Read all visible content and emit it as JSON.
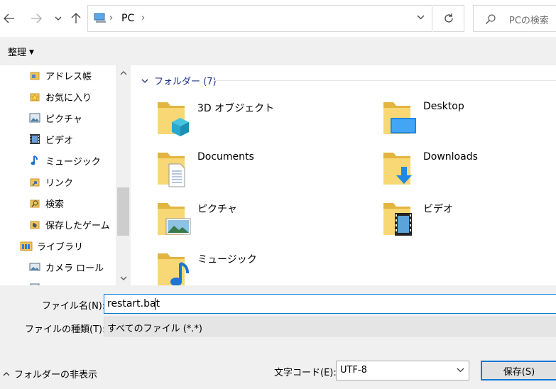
{
  "address": {
    "crumb": "PC"
  },
  "search": {
    "placeholder": "PCの検索"
  },
  "toolbar": {
    "organize_label": "整理"
  },
  "sidebar": {
    "items": [
      {
        "label": "アドレス帳",
        "icon": "address-book-icon"
      },
      {
        "label": "お気に入り",
        "icon": "favorites-icon"
      },
      {
        "label": "ピクチャ",
        "icon": "pictures-icon"
      },
      {
        "label": "ビデオ",
        "icon": "videos-icon"
      },
      {
        "label": "ミュージック",
        "icon": "music-icon"
      },
      {
        "label": "リンク",
        "icon": "links-icon"
      },
      {
        "label": "検索",
        "icon": "searches-icon"
      },
      {
        "label": "保存したゲーム",
        "icon": "saved-games-icon"
      },
      {
        "label": "ライブラリ",
        "icon": "libraries-icon"
      },
      {
        "label": "カメラ ロール",
        "icon": "camera-roll-icon"
      }
    ]
  },
  "content": {
    "group_header": "フォルダー (7)",
    "folders": [
      {
        "name": "3D オブジェクト",
        "icon": "3d-objects-folder-icon"
      },
      {
        "name": "Desktop",
        "icon": "desktop-folder-icon"
      },
      {
        "name": "Documents",
        "icon": "documents-folder-icon"
      },
      {
        "name": "Downloads",
        "icon": "downloads-folder-icon"
      },
      {
        "name": "ピクチャ",
        "icon": "pictures-folder-icon"
      },
      {
        "name": "ビデオ",
        "icon": "videos-folder-icon"
      },
      {
        "name": "ミュージック",
        "icon": "music-folder-icon"
      }
    ]
  },
  "form": {
    "filename_label": "ファイル名(N):",
    "filename_value": "restart.bat",
    "filetype_label": "ファイルの種類(T):",
    "filetype_value": "すべてのファイル  (*.*)",
    "hide_folders_label": "フォルダーの非表示",
    "encoding_label": "文字コード(E):",
    "encoding_value": "UTF-8",
    "save_label": "保存(S)"
  },
  "colors": {
    "accent": "#0078d7",
    "group_header": "#1e3287",
    "folder": "#f8d775"
  }
}
